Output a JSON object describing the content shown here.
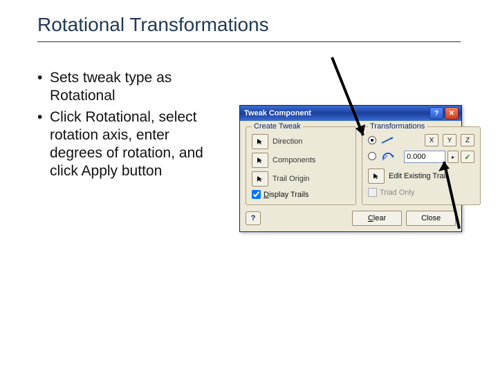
{
  "slide": {
    "title": "Rotational Transformations",
    "bullets": [
      "Sets tweak type as Rotational",
      "Click Rotational, select rotation axis, enter degrees of rotation, and click Apply button"
    ]
  },
  "dialog": {
    "title": "Tweak Component",
    "groups": {
      "create": {
        "legend": "Create Tweak",
        "direction": "Direction",
        "components": "Components",
        "trail_origin": "Trail Origin",
        "display_trails": "Display Trails"
      },
      "transform": {
        "legend": "Transformations",
        "axis_x": "X",
        "axis_y": "Y",
        "axis_z": "Z",
        "value": "0.000",
        "edit_trail": "Edit Existing Trail",
        "triad_only": "Triad Only"
      }
    },
    "footer": {
      "clear": "Clear",
      "close": "Close"
    }
  }
}
